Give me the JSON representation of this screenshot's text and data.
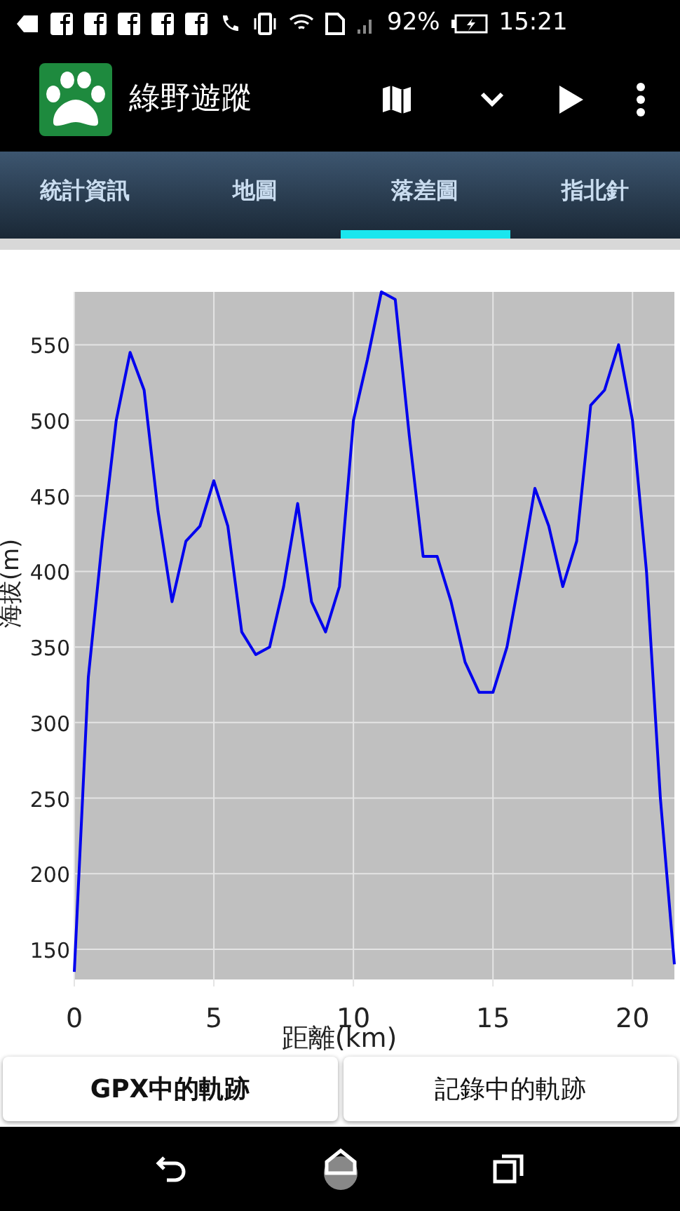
{
  "status_bar": {
    "battery": "92%",
    "time": "15:21"
  },
  "app_bar": {
    "title": "綠野遊蹤"
  },
  "tabs": [
    {
      "label": "統計資訊",
      "selected": false
    },
    {
      "label": "地圖",
      "selected": false
    },
    {
      "label": "落差圖",
      "selected": true
    },
    {
      "label": "指北針",
      "selected": false
    }
  ],
  "chart_data": {
    "type": "line",
    "xlabel": "距離(km)",
    "ylabel": "海拔(m)",
    "xlim": [
      0,
      21.5
    ],
    "ylim": [
      130,
      585
    ],
    "xticks": [
      0,
      5,
      10,
      15,
      20
    ],
    "yticks": [
      150,
      200,
      250,
      300,
      350,
      400,
      450,
      500,
      550
    ],
    "x": [
      0,
      0.5,
      1,
      1.5,
      2,
      2.5,
      3,
      3.5,
      4,
      4.5,
      5,
      5.5,
      6,
      6.5,
      7,
      7.5,
      8,
      8.5,
      9,
      9.5,
      10,
      10.5,
      11,
      11.5,
      12,
      12.5,
      13,
      13.5,
      14,
      14.5,
      15,
      15.5,
      16,
      16.5,
      17,
      17.5,
      18,
      18.5,
      19,
      19.5,
      20,
      20.5,
      21,
      21.5
    ],
    "grid": true,
    "series": [
      {
        "color": "#0000ee",
        "values": [
          135,
          330,
          420,
          500,
          545,
          520,
          440,
          380,
          420,
          430,
          460,
          430,
          360,
          345,
          350,
          390,
          445,
          380,
          360,
          390,
          500,
          540,
          585,
          580,
          490,
          410,
          410,
          380,
          340,
          320,
          320,
          350,
          400,
          455,
          430,
          390,
          420,
          510,
          520,
          550,
          500,
          400,
          250,
          140
        ]
      }
    ]
  },
  "buttons": [
    {
      "label": "GPX中的軌跡",
      "selected": true
    },
    {
      "label": "記錄中的軌跡",
      "selected": false
    }
  ]
}
